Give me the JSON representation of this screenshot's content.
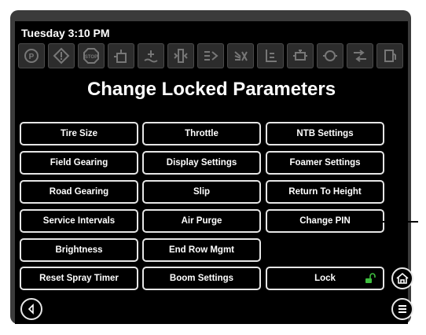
{
  "header": {
    "datetime": "Tuesday 3:10 PM"
  },
  "status_icons": [
    "parking-brake-icon",
    "warning-icon",
    "stop-icon",
    "hydrostatic-oil-icon",
    "coolant-level-icon",
    "indicator-icon",
    "boom-control-icon",
    "no-spray-icon",
    "boom-height-icon",
    "engine-icon",
    "transmission-icon",
    "road-mode-icon",
    "fuel-icon"
  ],
  "page": {
    "title": "Change Locked Parameters"
  },
  "buttons": {
    "tire_size": "Tire Size",
    "throttle": "Throttle",
    "ntb_settings": "NTB Settings",
    "field_gearing": "Field Gearing",
    "display_settings": "Display Settings",
    "foamer_settings": "Foamer Settings",
    "road_gearing": "Road Gearing",
    "slip": "Slip",
    "return_to_height": "Return To Height",
    "service_intervals": "Service Intervals",
    "air_purge": "Air Purge",
    "change_pin": "Change PIN",
    "brightness": "Brightness",
    "end_row_mgmt": "End Row Mgmt",
    "reset_spray_timer": "Reset Spray Timer",
    "boom_settings": "Boom Settings",
    "lock": "Lock"
  },
  "colors": {
    "lock_icon": "#3fbf3f",
    "arrow": "#000000"
  }
}
